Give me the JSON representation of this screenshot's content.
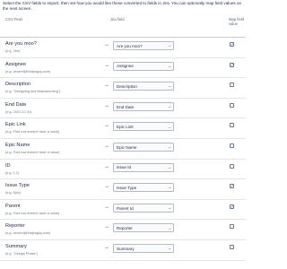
{
  "intro": "Select the CSV fields to import, then set how you would like these converted to fields in Jira. You can optionally map field values on the next screen.",
  "headers": {
    "csv_field": "CSV Field",
    "jira_field": "Jira field",
    "map_values": "Map field value"
  },
  "rows": [
    {
      "name": "Are you moo?",
      "example": "(e.g. Yes)",
      "jira_field": "Are you moo?",
      "map": true
    },
    {
      "name": "Assignee",
      "example": "(e.g. vincent@thejiraguy.com)",
      "jira_field": "Assignee",
      "map": true
    },
    {
      "name": "Description",
      "example": "(e.g. \"Designing and Brainstorming\")",
      "jira_field": "Description",
      "map": false
    },
    {
      "name": "End Date",
      "example": "(e.g. 2021-07-31)",
      "jira_field": "End Date",
      "map": false
    },
    {
      "name": "Epic Link",
      "example": "(e.g. First row doesn't have a value)",
      "jira_field": "Epic Link",
      "map": false
    },
    {
      "name": "Epic Name",
      "example": "(e.g. First row doesn't have a value)",
      "jira_field": "Epic Name",
      "map": false
    },
    {
      "name": "ID",
      "example": "(e.g. 1.1)",
      "jira_field": "Issue Id",
      "map": false
    },
    {
      "name": "Issue Type",
      "example": "(e.g. Epic)",
      "jira_field": "Issue Type",
      "map": true
    },
    {
      "name": "Parent",
      "example": "(e.g. First row doesn't have a value)",
      "jira_field": "Parent Id",
      "map": true
    },
    {
      "name": "Reporter",
      "example": "(e.g. vincent@thejiraguy.com)",
      "jira_field": "Reporter",
      "map": false
    },
    {
      "name": "Summary",
      "example": "(e.g. \"Design Phase\")",
      "jira_field": "Summary",
      "map": false
    }
  ],
  "icons": {
    "arrow": "→",
    "dropdown": "⌄",
    "check": "✓"
  }
}
